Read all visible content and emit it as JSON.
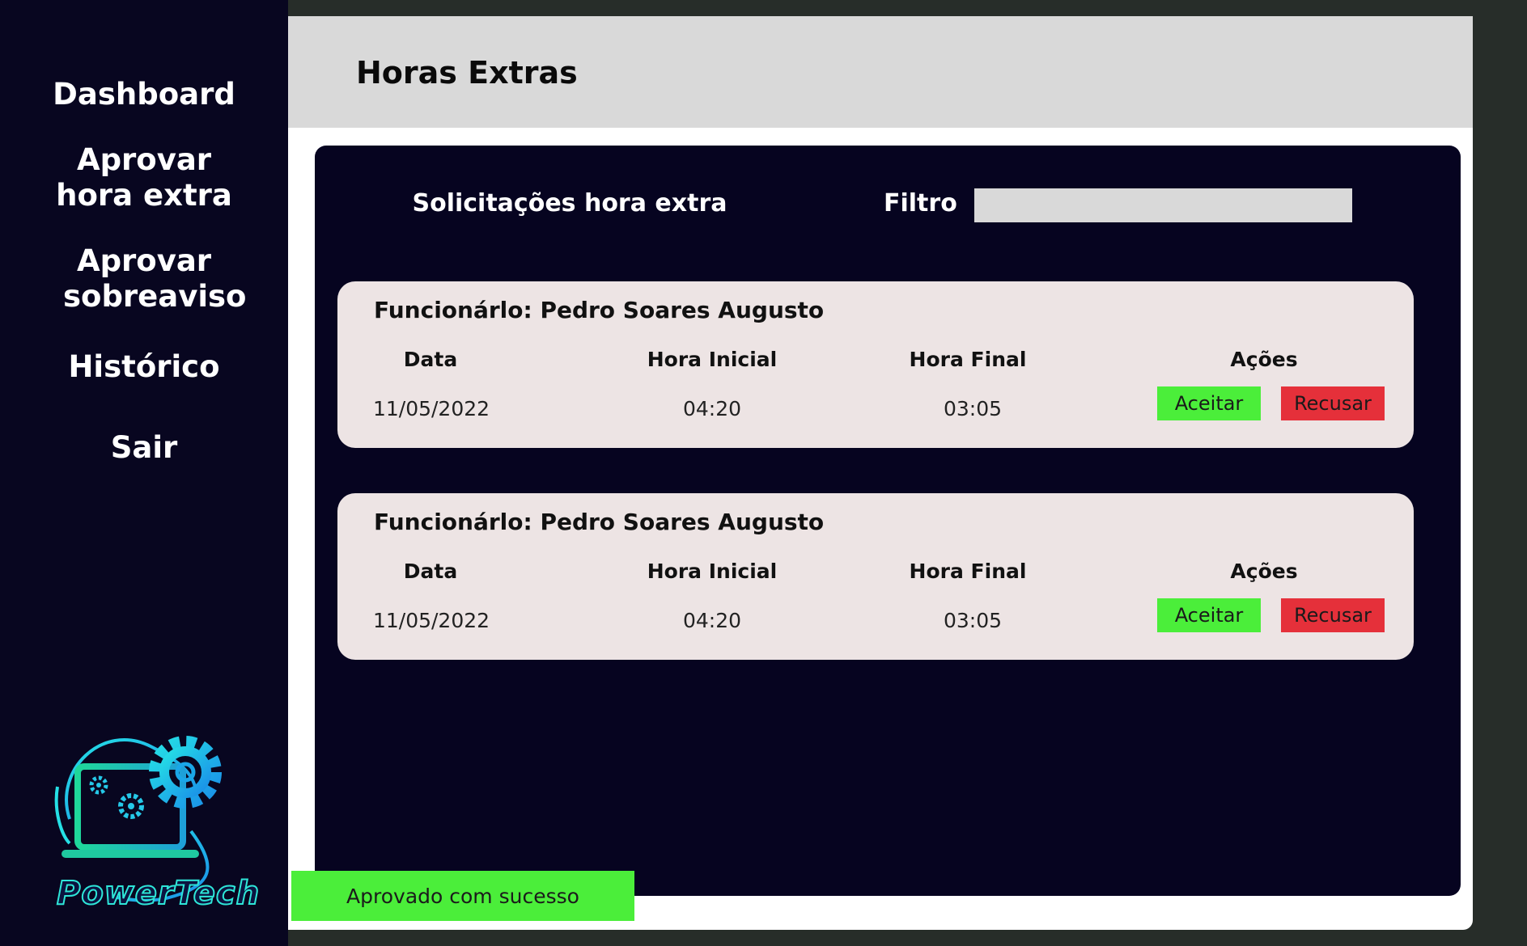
{
  "sidebar": {
    "items": [
      {
        "label": "Dashboard"
      },
      {
        "label": "Aprovar hora extra"
      },
      {
        "label": "Aprovar sobreaviso"
      },
      {
        "label": "Histórico"
      },
      {
        "label": "Sair"
      }
    ],
    "logo_text": "PowerTech"
  },
  "header": {
    "title": "Horas Extras"
  },
  "panel": {
    "title": "Solicitações hora extra",
    "filter_label": "Filtro",
    "filter_value": ""
  },
  "table": {
    "columns": [
      "Data",
      "Hora Inicial",
      "Hora Final",
      "Ações"
    ]
  },
  "requests": [
    {
      "employee": "Funcionárlo: Pedro Soares Augusto",
      "date": "11/05/2022",
      "start": "04:20",
      "end": "03:05",
      "accept_label": "Aceitar",
      "reject_label": "Recusar"
    },
    {
      "employee": "Funcionárlo: Pedro Soares Augusto",
      "date": "11/05/2022",
      "start": "04:20",
      "end": "03:05",
      "accept_label": "Aceitar",
      "reject_label": "Recusar"
    }
  ],
  "toast": {
    "message": "Aprovado com sucesso"
  },
  "colors": {
    "sidebar_bg": "#080620",
    "accept": "#4bee3a",
    "reject": "#e5303a",
    "card_bg": "#ede4e4"
  }
}
